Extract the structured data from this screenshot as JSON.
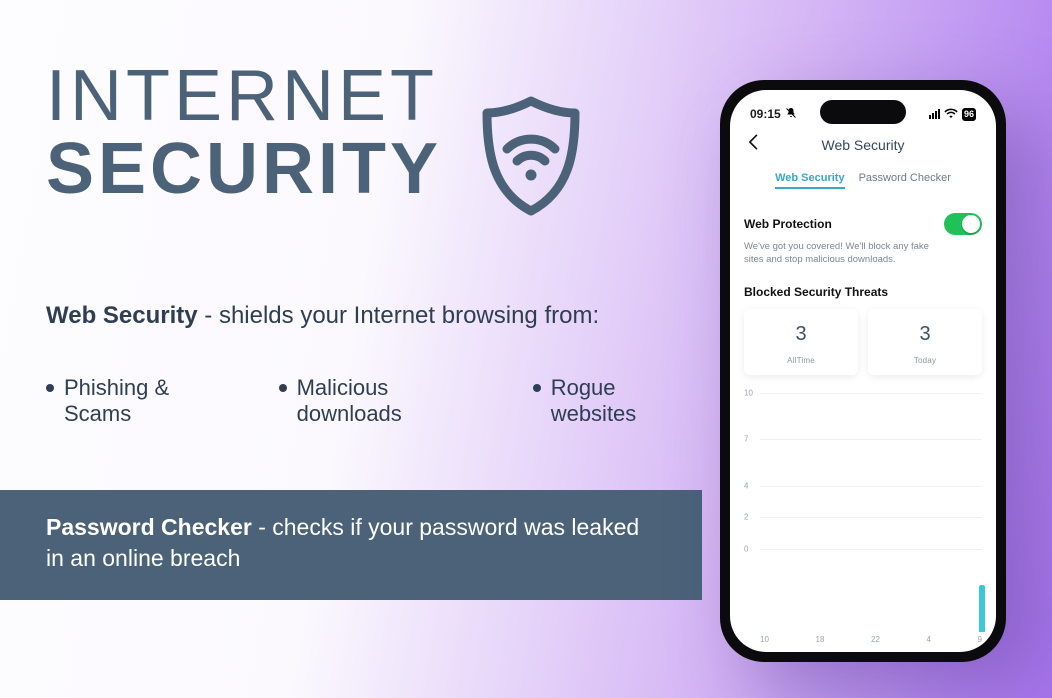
{
  "headline": {
    "line1": "INTERNET",
    "line2": "SECURITY"
  },
  "feature": {
    "lead_strong": "Web Security",
    "lead_rest": " - shields your Internet browsing from:",
    "bullets": [
      "Phishing & Scams",
      "Malicious downloads",
      "Rogue websites"
    ]
  },
  "password_band": {
    "strong": "Password Checker",
    "rest": " - checks if your password was leaked in an online breach"
  },
  "phone": {
    "status": {
      "time": "09:15",
      "battery": "96"
    },
    "header": {
      "title": "Web Security"
    },
    "tabs": {
      "active": "Web Security",
      "inactive": "Password Checker"
    },
    "protection": {
      "title": "Web Protection",
      "desc": "We've got you covered! We'll block any fake sites and stop malicious downloads.",
      "toggled_on": true
    },
    "threats": {
      "title": "Blocked Security Threats",
      "cards": [
        {
          "value": "3",
          "caption": "AllTime"
        },
        {
          "value": "3",
          "caption": "Today"
        }
      ]
    }
  },
  "chart_data": {
    "type": "bar",
    "title": "",
    "xlabel": "",
    "ylabel": "",
    "ylim": [
      0,
      10
    ],
    "y_ticks": [
      10,
      7,
      4,
      2,
      0
    ],
    "categories": [
      "10",
      "18",
      "22",
      "4",
      "9"
    ],
    "values": [
      0,
      0,
      0,
      0,
      3
    ]
  }
}
